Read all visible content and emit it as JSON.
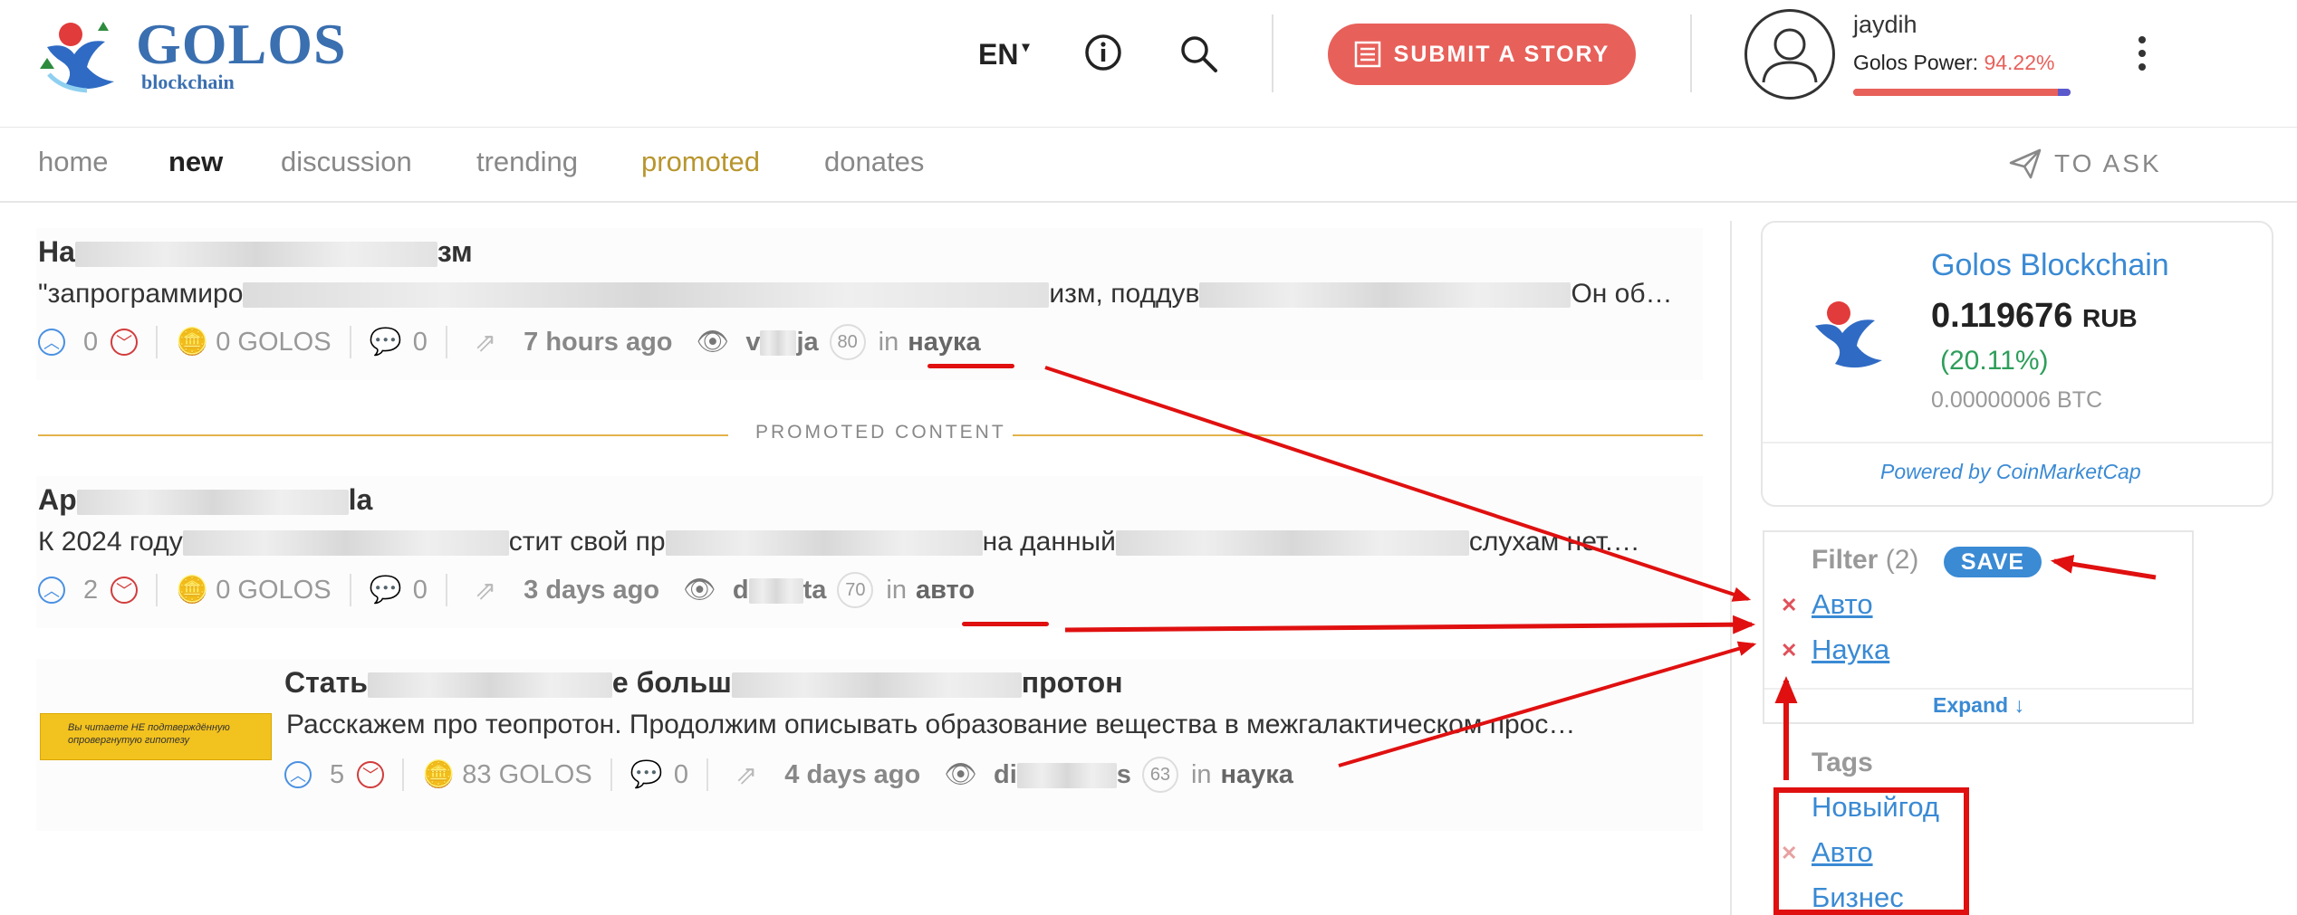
{
  "header": {
    "logo_text": "GOLOS",
    "logo_sub": "blockchain",
    "lang": "EN",
    "submit_label": "SUBMIT A STORY",
    "username": "jaydih",
    "power_label": "Golos Power:",
    "power_value": "94.22%",
    "power_fraction": 0.9422
  },
  "nav": {
    "items": [
      {
        "label": "home",
        "state": "normal"
      },
      {
        "label": "new",
        "state": "active"
      },
      {
        "label": "discussion",
        "state": "normal"
      },
      {
        "label": "trending",
        "state": "normal"
      },
      {
        "label": "promoted",
        "state": "promoted"
      },
      {
        "label": "donates",
        "state": "normal"
      }
    ],
    "ask_label": "TO ASK"
  },
  "promo_label": "PROMOTED CONTENT",
  "posts": [
    {
      "title_start": "На",
      "title_end": "зм",
      "body_start": "\"запрограммиро",
      "body_mid": "изм, поддув",
      "body_end": "Он об…",
      "upvotes": "0",
      "payout": "0 GOLOS",
      "comments": "0",
      "time": "7 hours ago",
      "author_start": "v",
      "author_end": "ja",
      "reputation": "80",
      "in_label": "in",
      "category": "наука"
    },
    {
      "title_start": "Ар",
      "title_end": "la",
      "body_start": "К 2024 году",
      "body_mid": "стит свой пр",
      "body_mid2": "на данный",
      "body_end": "слухам нет.…",
      "upvotes": "2",
      "payout": "0 GOLOS",
      "comments": "0",
      "time": "3 days ago",
      "author_start": "d",
      "author_end": "ta",
      "reputation": "70",
      "in_label": "in",
      "category": "авто"
    },
    {
      "title_start": "Стать",
      "title_mid": "е больш",
      "title_end": "протон",
      "body": "Расскажем про теопротон. Продолжим описывать образование вещества в межгалактическом прос…",
      "upvotes": "5",
      "payout": "83 GOLOS",
      "comments": "0",
      "time": "4 days ago",
      "author_start": "di",
      "author_end": "s",
      "reputation": "63",
      "in_label": "in",
      "category": "наука",
      "thumb_text": "Вы читаете НЕ подтверждённую опровергнутую гипотезу"
    }
  ],
  "market": {
    "title": "Golos Blockchain",
    "price": "0.119676",
    "unit": "RUB",
    "change": "(20.11%)",
    "btc": "0.00000006 BTC",
    "powered": "Powered by CoinMarketCap"
  },
  "filter": {
    "label": "Filter",
    "count": "(2)",
    "save_label": "SAVE",
    "tags": [
      "Авто",
      "Наука"
    ],
    "expand_label": "Expand ↓"
  },
  "tags": {
    "label": "Tags",
    "items": [
      "Новыйгод",
      "Авто",
      "Бизнес"
    ]
  },
  "colors": {
    "brand_blue": "#3a6fb0",
    "accent_red": "#e8605a",
    "link_blue": "#3a8ad4",
    "annotation_red": "#e01010",
    "promo_gold": "#b8962e"
  }
}
